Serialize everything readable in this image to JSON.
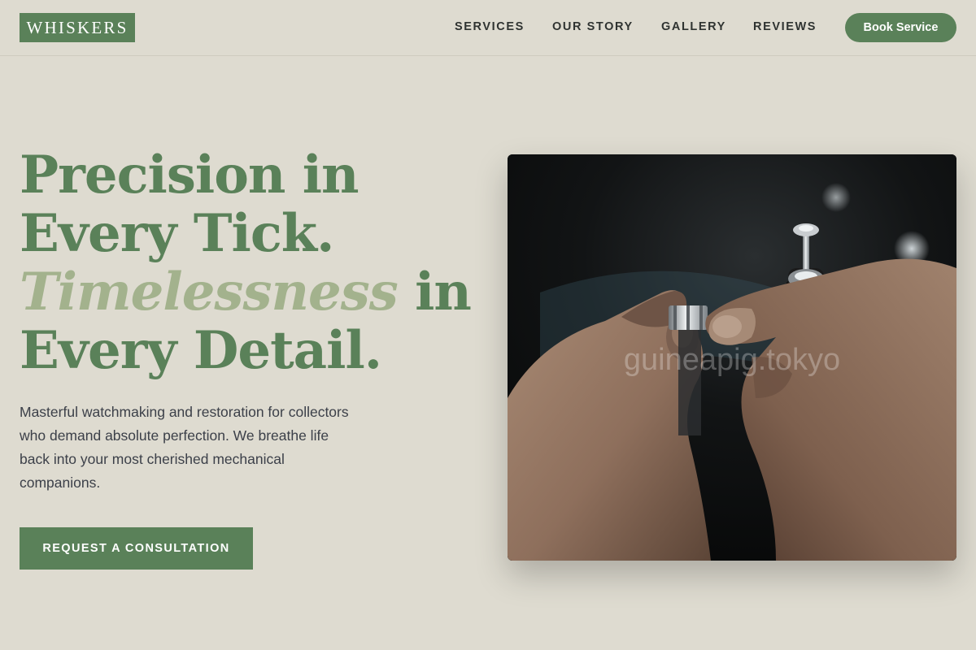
{
  "header": {
    "logo": "WHISKERS",
    "nav": [
      "SERVICES",
      "OUR STORY",
      "GALLERY",
      "REVIEWS"
    ],
    "book_label": "Book Service"
  },
  "hero": {
    "headline_line1": "Precision in",
    "headline_line2": "Every Tick.",
    "headline_accent": "Timelessness",
    "headline_line3_rest": " in",
    "headline_line4": "Every Detail.",
    "lede": "Masterful watchmaking and restoration for collectors who demand absolute perfection. We breathe life back into your most cherished mechanical companions.",
    "cta_label": "REQUEST A CONSULTATION",
    "photo_watermark": "guineapig.tokyo"
  },
  "colors": {
    "background": "#dedbd0",
    "brand_green": "#5a8159",
    "accent_sage": "#a3b28d",
    "nav_text": "#2f3331"
  },
  "icons": [
    "watch-repair-photo"
  ]
}
